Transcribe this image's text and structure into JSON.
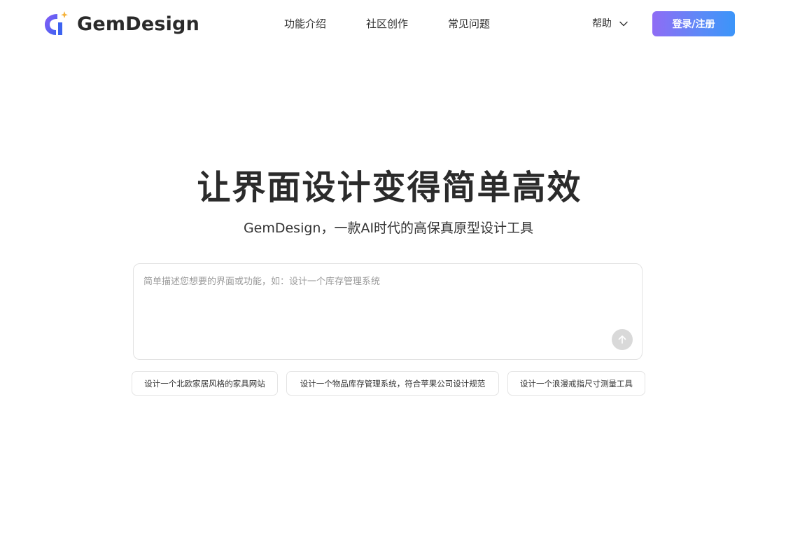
{
  "header": {
    "brand": "GemDesign",
    "nav": [
      {
        "label": "功能介绍"
      },
      {
        "label": "社区创作"
      },
      {
        "label": "常见问题"
      }
    ],
    "help_label": "帮助",
    "login_label": "登录/注册"
  },
  "hero": {
    "title": "让界面设计变得简单高效",
    "subtitle": "GemDesign，一款AI时代的高保真原型设计工具"
  },
  "prompt": {
    "placeholder": "简单描述您想要的界面或功能，如：设计一个库存管理系统",
    "value": ""
  },
  "suggestions": [
    {
      "label": "设计一个北欧家居风格的家具网站"
    },
    {
      "label": "设计一个物品库存管理系统，符合苹果公司设计规范"
    },
    {
      "label": "设计一个浪漫戒指尺寸测量工具"
    }
  ],
  "icons": {
    "logo": "gemdesign-logo-icon",
    "help_chevron": "chevron-down-icon",
    "send": "arrow-up-icon"
  },
  "colors": {
    "login_gradient_start": "#8f6cf5",
    "login_gradient_end": "#3b95f9",
    "logo_blue": "#4a5cf0",
    "logo_purple": "#8a5cf6",
    "logo_spark": "#f5b23a",
    "send_button": "#d9d9d9"
  }
}
